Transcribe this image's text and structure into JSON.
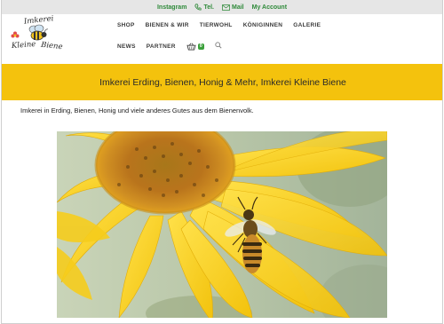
{
  "topbar": {
    "links": [
      {
        "label": "Instagram",
        "icon": "instagram-icon"
      },
      {
        "label": "Tel.",
        "icon": "phone-icon"
      },
      {
        "label": "Mail",
        "icon": "mail-icon"
      },
      {
        "label": "My Account",
        "icon": "account-icon"
      }
    ]
  },
  "logo": {
    "line1": "Imkerei",
    "line2": "Kleine",
    "line3": "Biene"
  },
  "nav": {
    "row1": [
      "SHOP",
      "BIENEN & WIR",
      "TIERWOHL",
      "KÖNIGINNEN",
      "GALERIE"
    ],
    "row2": [
      "NEWS",
      "PARTNER"
    ],
    "cart_count": "0"
  },
  "banner": {
    "title": "Imkerei Erding, Bienen, Honig & Mehr, Imkerei Kleine Biene"
  },
  "intro": {
    "text": "Imkerei in Erding, Bienen, Honig und viele anderes Gutes aus dem Bienenvolk."
  },
  "colors": {
    "banner": "#f4c20d",
    "topbar_link": "#2f8a3a",
    "topbar_bg": "#e6e6e6"
  }
}
